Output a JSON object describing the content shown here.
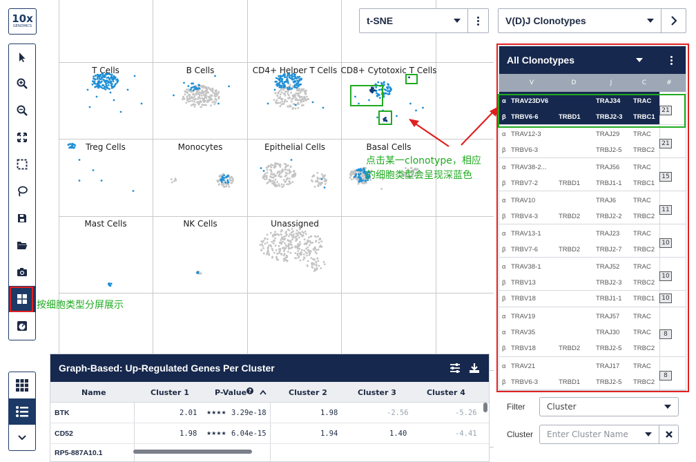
{
  "logo": {
    "big": "10x",
    "small": "GENOMICS"
  },
  "toolbar": {
    "tools": [
      "select-tool",
      "zoom-in-tool",
      "zoom-out-tool",
      "fit-view-tool",
      "box-select-tool",
      "lasso-tool",
      "save-tool",
      "open-folder-tool",
      "screenshot-tool",
      "split-view-tool",
      "panel-settings-tool"
    ],
    "active": "split-view-tool"
  },
  "projection_select": {
    "value": "t-SNE"
  },
  "view_select": {
    "value": "V(D)J Clonotypes"
  },
  "panels": {
    "titles": [
      "T Cells",
      "B Cells",
      "CD4+ Helper T Cells",
      "CD8+ Cytotoxic T Cells",
      "Treg Cells",
      "Monocytes",
      "Epithelial Cells",
      "Basal Cells",
      "Mast Cells",
      "NK Cells",
      "Unassigned"
    ]
  },
  "annotations": {
    "clonotype_note_line1": "点击某一clonotype，相应",
    "clonotype_note_line2": "的细胞类型会呈现深蓝色",
    "split_note": "按细胞类型分屏展示"
  },
  "clonotypes": {
    "header": "All Clonotypes",
    "columns": [
      "V",
      "D",
      "J",
      "C",
      "#"
    ],
    "rows": [
      {
        "a": [
          "α",
          "TRAV23DV6",
          "",
          "TRAJ34",
          "TRAC"
        ],
        "b": [
          "β",
          "TRBV6-6",
          "TRBD1",
          "TRBJ2-3",
          "TRBC1"
        ],
        "count": "21",
        "selected": true
      },
      {
        "a": [
          "α",
          "TRAV12-3",
          "",
          "TRAJ29",
          "TRAC"
        ],
        "b": [
          "β",
          "TRBV6-3",
          "",
          "TRBJ2-5",
          "TRBC2"
        ],
        "count": "21"
      },
      {
        "a": [
          "α",
          "TRAV38-2...",
          "",
          "TRAJ56",
          "TRAC"
        ],
        "b": [
          "β",
          "TRBV7-2",
          "TRBD1",
          "TRBJ1-1",
          "TRBC1"
        ],
        "count": "15"
      },
      {
        "a": [
          "α",
          "TRAV10",
          "",
          "TRAJ6",
          "TRAC"
        ],
        "b": [
          "β",
          "TRBV4-3",
          "TRBD2",
          "TRBJ2-2",
          "TRBC2"
        ],
        "count": "11"
      },
      {
        "a": [
          "α",
          "TRAV13-1",
          "",
          "TRAJ23",
          "TRAC"
        ],
        "b": [
          "β",
          "TRBV7-6",
          "TRBD2",
          "TRBJ2-7",
          "TRBC2"
        ],
        "count": "10"
      },
      {
        "a": [
          "α",
          "TRAV38-1",
          "",
          "TRAJ52",
          "TRAC"
        ],
        "b": [
          "β",
          "TRBV13",
          "",
          "TRBJ2-3",
          "TRBC2"
        ],
        "count": "10"
      },
      {
        "single": [
          "β",
          "TRBV18",
          "",
          "TRBJ1-1",
          "TRBC1"
        ],
        "count": "10"
      },
      {
        "a": [
          "α",
          "TRAV19",
          "",
          "TRAJ57",
          "TRAC"
        ],
        "b": [
          "α",
          "TRAV35",
          "",
          "TRAJ30",
          "TRAC"
        ],
        "c": [
          "β",
          "TRBV18",
          "TRBD2",
          "TRBJ2-5",
          "TRBC2"
        ],
        "count": "8"
      },
      {
        "a": [
          "α",
          "TRAV21",
          "",
          "TRAJ17",
          "TRAC"
        ],
        "b": [
          "β",
          "TRBV6-3",
          "TRBD1",
          "TRBJ2-5",
          "TRBC2"
        ],
        "count": "8"
      }
    ]
  },
  "filter": {
    "label": "Filter",
    "value": "Cluster"
  },
  "cluster_filter": {
    "label": "Cluster",
    "placeholder": "Enter Cluster Name"
  },
  "genes": {
    "title": "Graph-Based: Up-Regulated Genes Per Cluster",
    "columns": [
      "Name",
      "Cluster 1",
      "P-Value",
      "Cluster 2",
      "Cluster 3",
      "Cluster 4"
    ],
    "rows": [
      {
        "name": "BTK",
        "c1": "2.01",
        "stars": "★★★★",
        "p": "3.29e-18",
        "c2": "1.98",
        "c3": "-2.56",
        "c4": "-5.26"
      },
      {
        "name": "CD52",
        "c1": "1.98",
        "stars": "★★★★",
        "p": "6.04e-15",
        "c2": "1.94",
        "c3": "1.40",
        "c4": "-4.41"
      },
      {
        "name": "RP5-887A10.1",
        "c1": "",
        "stars": "",
        "p": "",
        "c2": "",
        "c3": "",
        "c4": ""
      }
    ]
  },
  "colors": {
    "navy": "#16284d",
    "cell_blue": "#1e8fd6",
    "cell_dark": "#0a3b78",
    "cell_grey": "#c4c4c4",
    "highlight_red": "#e02020",
    "highlight_green": "#1faa1f"
  }
}
